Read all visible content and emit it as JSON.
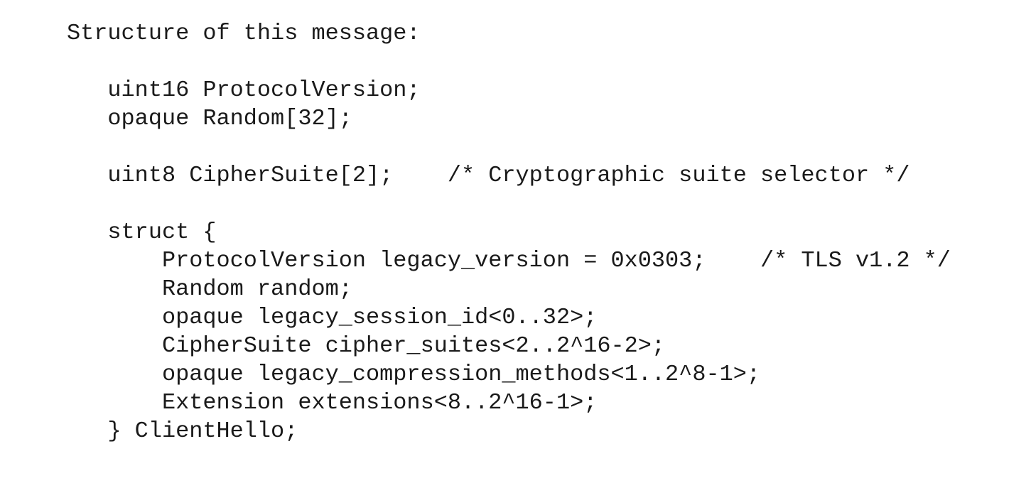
{
  "document": {
    "lines": [
      "Structure of this message:",
      "",
      "   uint16 ProtocolVersion;",
      "   opaque Random[32];",
      "",
      "   uint8 CipherSuite[2];    /* Cryptographic suite selector */",
      "",
      "   struct {",
      "       ProtocolVersion legacy_version = 0x0303;    /* TLS v1.2 */",
      "       Random random;",
      "       opaque legacy_session_id<0..32>;",
      "       CipherSuite cipher_suites<2..2^16-2>;",
      "       opaque legacy_compression_methods<1..2^8-1>;",
      "       Extension extensions<8..2^16-1>;",
      "   } ClientHello;"
    ]
  }
}
